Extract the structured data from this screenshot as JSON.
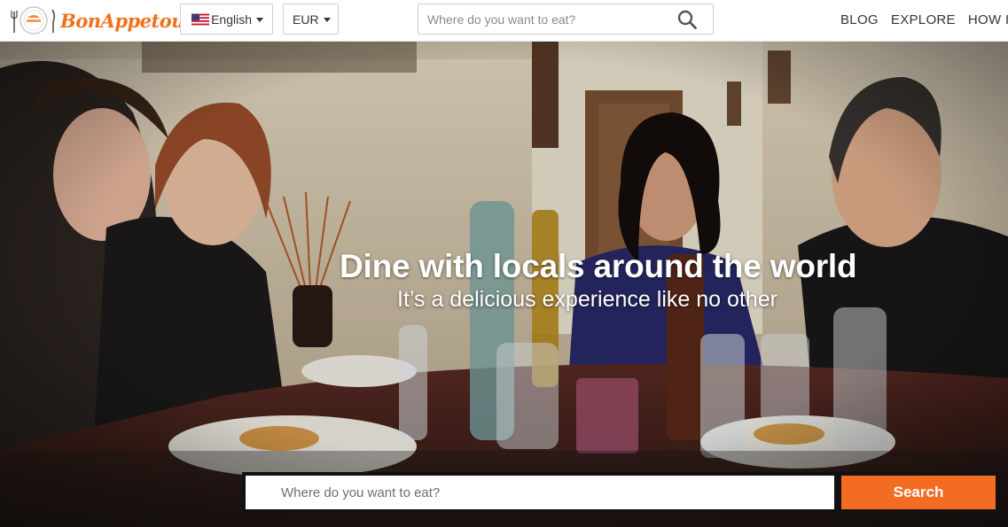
{
  "brand": {
    "name": "BonAppetour",
    "color": "#f0711d"
  },
  "header": {
    "language": {
      "label": "English",
      "flag_icon": "us-flag-icon"
    },
    "currency": {
      "label": "EUR"
    },
    "search": {
      "placeholder": "Where do you want to eat?",
      "icon": "search-icon"
    },
    "nav": [
      {
        "label": "BLOG"
      },
      {
        "label": "EXPLORE"
      },
      {
        "label": "HOW IT"
      }
    ]
  },
  "hero": {
    "title": "Dine with locals around the world",
    "subtitle": "It’s a delicious experience like no other",
    "search": {
      "placeholder": "Where do you want to eat?",
      "button_label": "Search",
      "button_color": "#f26c21"
    }
  }
}
